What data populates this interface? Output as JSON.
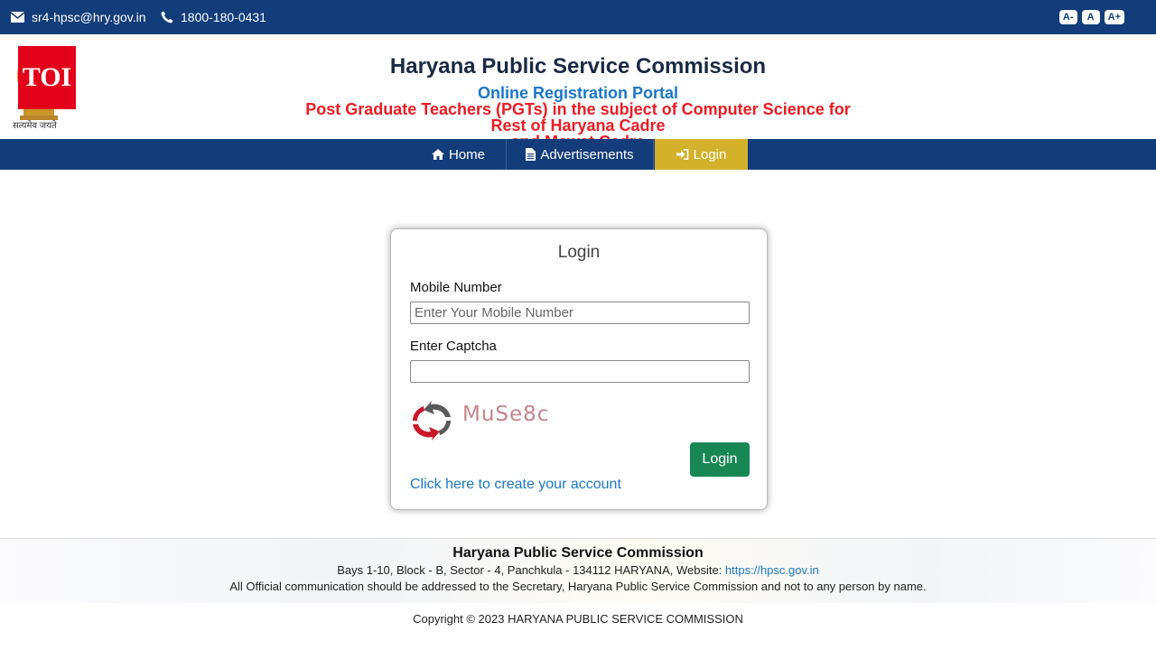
{
  "topbar": {
    "email": "sr4-hpsc@hry.gov.in",
    "phone": "1800-180-0431",
    "font_decrease": "A-",
    "font_reset": "A",
    "font_increase": "A+"
  },
  "header": {
    "logo_badge": "TOI",
    "emblem_caption": "सत्यमेव जयते",
    "title": "Haryana Public Service Commission",
    "portal": "Online Registration Portal",
    "post_line1": "Post Graduate Teachers (PGTs) in the subject of Computer Science for Rest of Haryana Cadre",
    "post_line2": "and Mewat Cadre"
  },
  "nav": {
    "items": [
      {
        "label": "Home",
        "icon": "home-icon"
      },
      {
        "label": "Advertisements",
        "icon": "document-icon"
      },
      {
        "label": "Login",
        "icon": "sign-in-icon",
        "active": true
      }
    ]
  },
  "login": {
    "title": "Login",
    "mobile_label": "Mobile Number",
    "mobile_placeholder": "Enter Your Mobile Number",
    "mobile_value": "",
    "captcha_label": "Enter Captcha",
    "captcha_value": "",
    "captcha_text": "MuSe8c",
    "submit_label": "Login",
    "create_account_link": "Click here to create your account"
  },
  "footer": {
    "title": "Haryana Public Service Commission",
    "address": "Bays 1-10, Block - B, Sector - 4, Panchkula - 134112 HARYANA, Website: ",
    "website": "https://hpsc.gov.in",
    "note": "All Official communication should be addressed to the Secretary, Haryana Public Service Commission and not to any person by name.",
    "copyright": "Copyright © 2023 HARYANA PUBLIC SERVICE COMMISSION"
  },
  "colors": {
    "nav_bg": "#123d7a",
    "nav_active": "#d3b12a",
    "title_blue": "#1b76c8",
    "title_red": "#ec1c24",
    "button_green": "#198754",
    "toi_red": "#e2001a"
  }
}
